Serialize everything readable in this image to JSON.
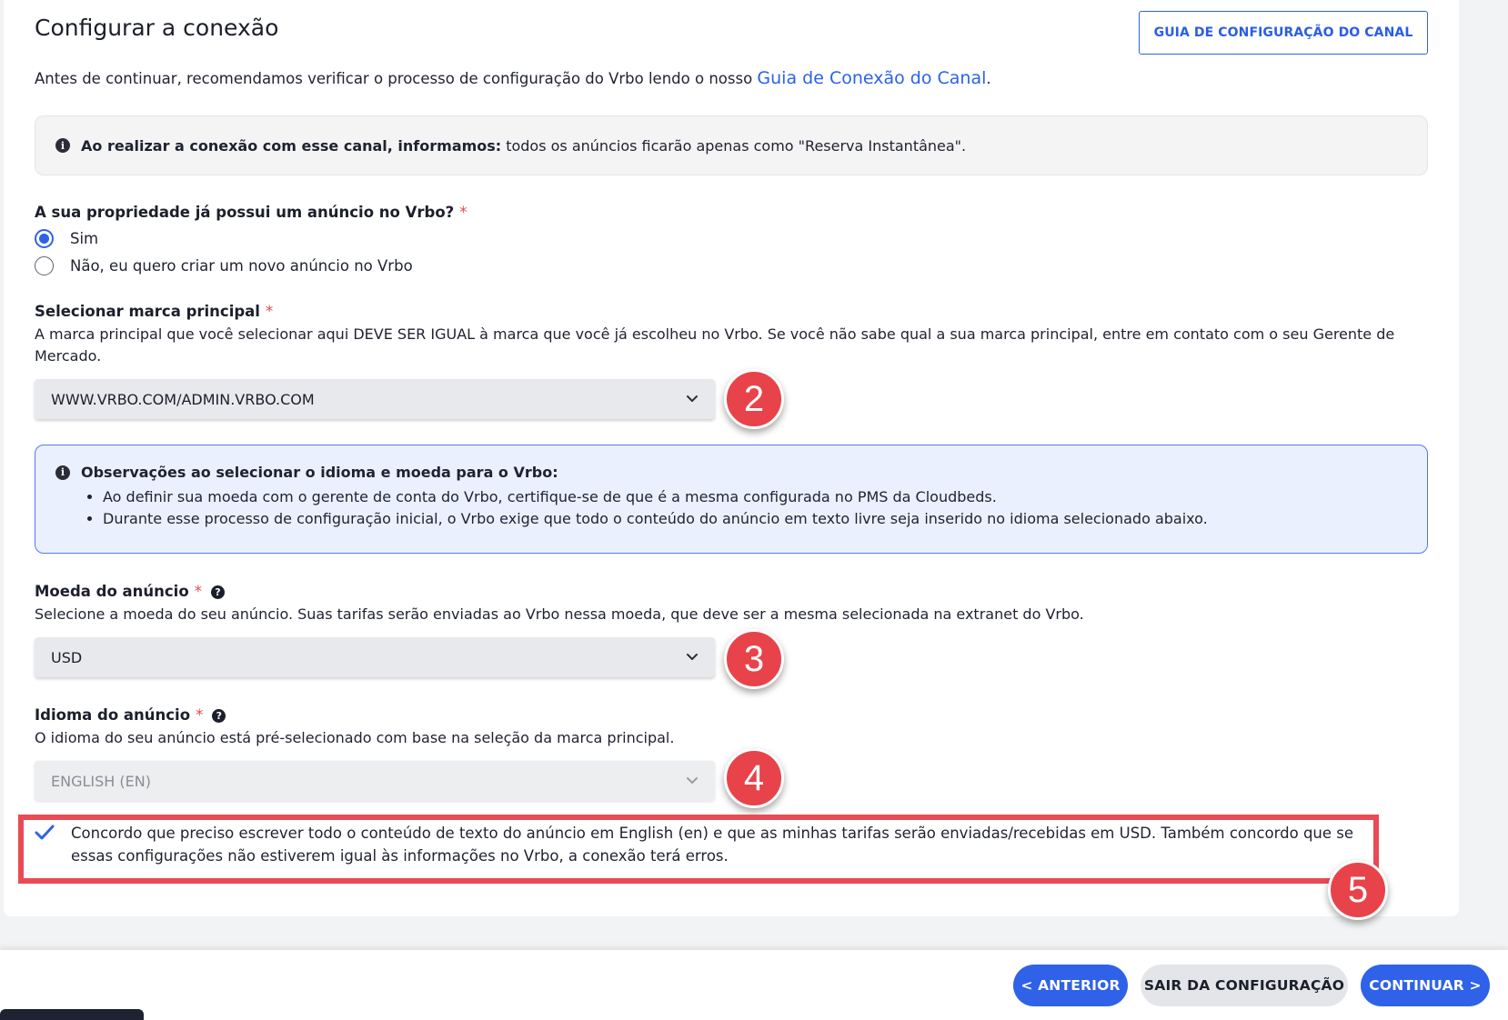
{
  "header": {
    "title": "Configurar a conexão",
    "guide_button": "GUIA DE CONFIGURAÇÃO DO CANAL"
  },
  "intro": {
    "text": "Antes de continuar, recomendamos verificar o processo de configuração do Vrbo lendo o nosso ",
    "link": "Guia de Conexão do Canal",
    "suffix": "."
  },
  "notice": {
    "bold": "Ao realizar a conexão com esse canal, informamos:",
    "text": "todos os anúncios ficarão apenas como \"Reserva Instantânea\"."
  },
  "listing_question": {
    "label": "A sua propriedade já possui um anúncio no Vrbo?",
    "required": "*",
    "options": [
      {
        "label": "Sim",
        "selected": true
      },
      {
        "label": "Não, eu quero criar um novo anúncio no Vrbo",
        "selected": false
      }
    ]
  },
  "brand": {
    "label": "Selecionar marca principal",
    "required": "*",
    "description": "A marca principal que você selecionar aqui DEVE SER IGUAL à marca que você já escolheu no Vrbo. Se você não sabe qual a sua marca principal, entre em contato com o seu Gerente de Mercado.",
    "value": "WWW.VRBO.COM/ADMIN.VRBO.COM"
  },
  "observations": {
    "title": "Observações ao selecionar o idioma e moeda para o Vrbo:",
    "items": [
      "Ao definir sua moeda com o gerente de conta do Vrbo, certifique-se de que é a mesma configurada no PMS da Cloudbeds.",
      "Durante esse processo de configuração inicial, o Vrbo exige que todo o conteúdo do anúncio em texto livre seja inserido no idioma selecionado abaixo."
    ]
  },
  "currency": {
    "label": "Moeda do anúncio",
    "required": "*",
    "description": "Selecione a moeda do seu anúncio. Suas tarifas serão enviadas ao Vrbo nessa moeda, que deve ser a mesma selecionada na extranet do Vrbo.",
    "value": "USD"
  },
  "language": {
    "label": "Idioma do anúncio",
    "required": "*",
    "description": "O idioma do seu anúncio está pré-selecionado com base na seleção da marca principal.",
    "value": "ENGLISH (EN)"
  },
  "agreement": {
    "checked": true,
    "text": "Concordo que preciso escrever todo o conteúdo de texto do anúncio em English (en) e que as minhas tarifas serão enviadas/recebidas em USD. Também concordo que se essas configurações não estiverem igual às informações no Vrbo, a conexão terá erros."
  },
  "badges": [
    "2",
    "3",
    "4",
    "5"
  ],
  "footer": {
    "back": "< ANTERIOR",
    "exit": "SAIR DA CONFIGURAÇÃO",
    "next": "CONTINUAR >"
  },
  "colors": {
    "primary": "#2f62e8",
    "badge": "#e8434a",
    "highlight_border": "#e94b55",
    "info_bg": "#eaf0fd"
  }
}
